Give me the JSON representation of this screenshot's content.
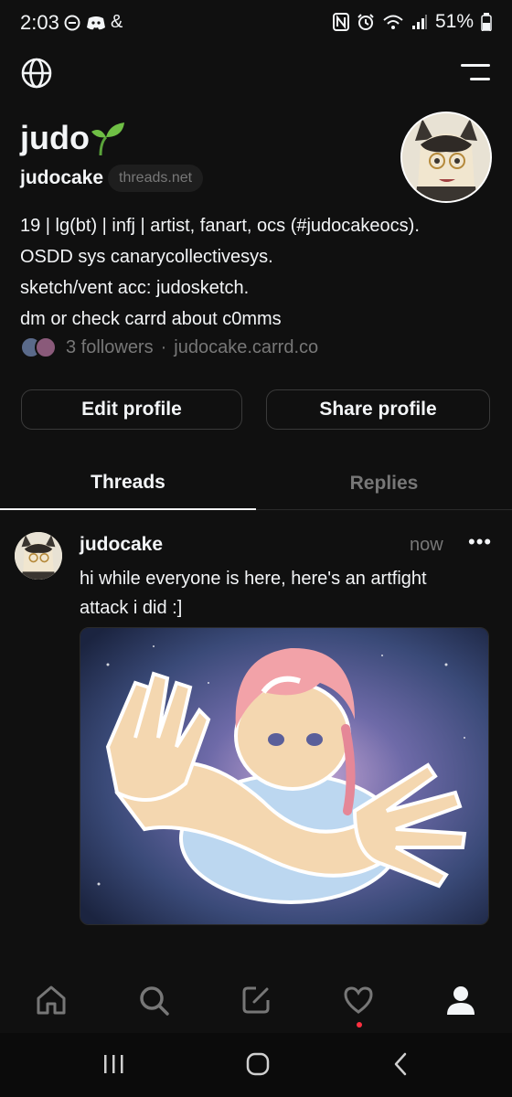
{
  "status_bar": {
    "time": "2:03",
    "left_icons": [
      "do-not-disturb-icon",
      "discord-icon",
      "threads-icon"
    ],
    "right_icons": [
      "nfc-icon",
      "alarm-icon",
      "wifi-icon",
      "signal-icon"
    ],
    "battery": "51%"
  },
  "header": {
    "left_icon": "globe-icon",
    "right_icon": "menu-icon"
  },
  "profile": {
    "name": "judo",
    "name_emoji_icon": "seedling-icon",
    "username": "judocake",
    "domain": "threads.net",
    "bio_lines": [
      "19 | lg(bt) | infj | artist, fanart, ocs (#judocakeocs).",
      "OSDD sys canarycollectivesys.",
      "sketch/vent acc: judosketch.",
      "dm or check carrd about c0mms"
    ],
    "followers": "3 followers",
    "separator": "·",
    "link": "judocake.carrd.co"
  },
  "buttons": {
    "edit": "Edit profile",
    "share": "Share profile"
  },
  "tabs": [
    {
      "label": "Threads",
      "active": true
    },
    {
      "label": "Replies",
      "active": false
    }
  ],
  "post": {
    "username": "judocake",
    "time": "now",
    "more": "•••",
    "text_lines": [
      "hi while everyone is here, here's an artfight",
      "attack i did :]"
    ],
    "image_icon": "artwork-image"
  },
  "bottom_nav": [
    {
      "icon": "home-icon"
    },
    {
      "icon": "search-icon"
    },
    {
      "icon": "compose-icon"
    },
    {
      "icon": "heart-icon"
    },
    {
      "icon": "profile-icon"
    }
  ],
  "system_nav": [
    "recents-icon",
    "home-circle-icon",
    "back-icon"
  ],
  "colors": {
    "background": "#101010",
    "text": "#f3f5f7",
    "muted": "#777777",
    "notification_dot": "#ff3040"
  }
}
